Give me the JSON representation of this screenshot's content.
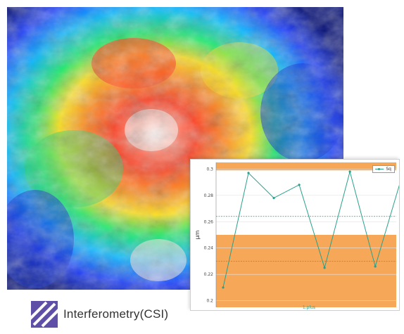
{
  "caption": "Interferometry(CSI)",
  "colors": {
    "series": "#29a08c",
    "band": "#f7a758",
    "logo": "#5f4fa6"
  },
  "chart_data": {
    "type": "line",
    "ylabel": "μm",
    "xlabel": "1.plus",
    "legend": "Sq",
    "legend_position": "top-right",
    "yticks": [
      0.2,
      0.22,
      0.24,
      0.26,
      0.28,
      0.3
    ],
    "ylim": [
      0.195,
      0.305
    ],
    "series": [
      {
        "name": "Sq",
        "values": [
          0.21,
          0.297,
          0.278,
          0.288,
          0.225,
          0.298,
          0.226,
          0.291
        ]
      }
    ],
    "limit_bands": [
      [
        0.195,
        0.25
      ],
      [
        0.299,
        0.305
      ]
    ],
    "reference_lines": [
      0.264,
      0.23
    ]
  }
}
